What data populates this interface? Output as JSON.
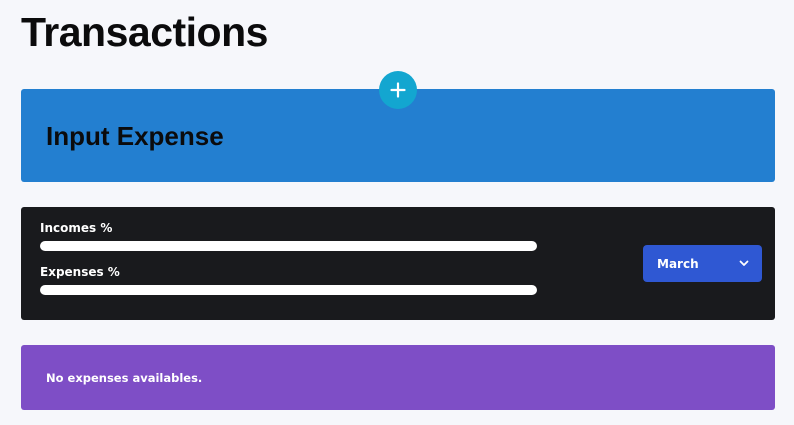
{
  "page": {
    "title": "Transactions"
  },
  "input_card": {
    "title": "Input Expense",
    "add_button_icon": "plus-icon"
  },
  "stats": {
    "incomes_label": "Incomes %",
    "expenses_label": "Expenses %",
    "incomes_percent": 0,
    "expenses_percent": 0
  },
  "month_select": {
    "selected": "March",
    "icon": "chevron-down-icon"
  },
  "expenses_list": {
    "empty_message": "No expenses availables."
  },
  "colors": {
    "background": "#f6f7fb",
    "input_card": "#237fd0",
    "add_button": "#13a6d0",
    "stats_card": "#191a1d",
    "month_select": "#2f58d3",
    "empty_card": "#7e4ec6"
  }
}
